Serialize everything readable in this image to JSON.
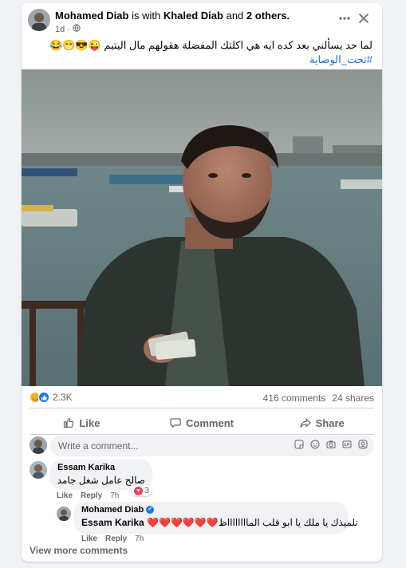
{
  "post": {
    "author": "Mohamed Diab",
    "with_text": "is with",
    "tagged": "Khaled Diab",
    "and_text": "and",
    "others": "2 others.",
    "time": "1d",
    "privacy_icon": "globe-icon",
    "text": "لما حد يسألني بعد كده ايه هي اكلتك المفضلة هقولهم مال اليتيم 😜😎😁😂",
    "hashtag": "#تحت_الوصاية"
  },
  "stats": {
    "reaction_count": "2.3K",
    "reaction_icons": [
      "haha-icon",
      "like-icon"
    ],
    "comments": "416 comments",
    "shares": "24 shares"
  },
  "actions": {
    "like": "Like",
    "comment": "Comment",
    "share": "Share"
  },
  "composer": {
    "placeholder": "Write a comment...",
    "icons": [
      "sticker-icon",
      "emoji-icon",
      "camera-icon",
      "gif-icon",
      "avatar-sticker-icon"
    ]
  },
  "comments": [
    {
      "author": "Essam Karika",
      "text": "صالح عامل شغل جامد",
      "like": "Like",
      "reply": "Reply",
      "time": "7h",
      "reaction_count": "3"
    }
  ],
  "reply": {
    "author": "Mohamed Diab",
    "mention": "Essam Karika",
    "text": "تلميذك يا ملك يا ابو قلب المااااااااظ❤️❤️❤️❤️❤️❤️",
    "like": "Like",
    "reply": "Reply",
    "time": "7h"
  },
  "view_more": "View more comments",
  "colors": {
    "accent": "#216fdb",
    "muted": "#65676b",
    "love": "#f33e58",
    "like_blue": "#1877f2"
  }
}
